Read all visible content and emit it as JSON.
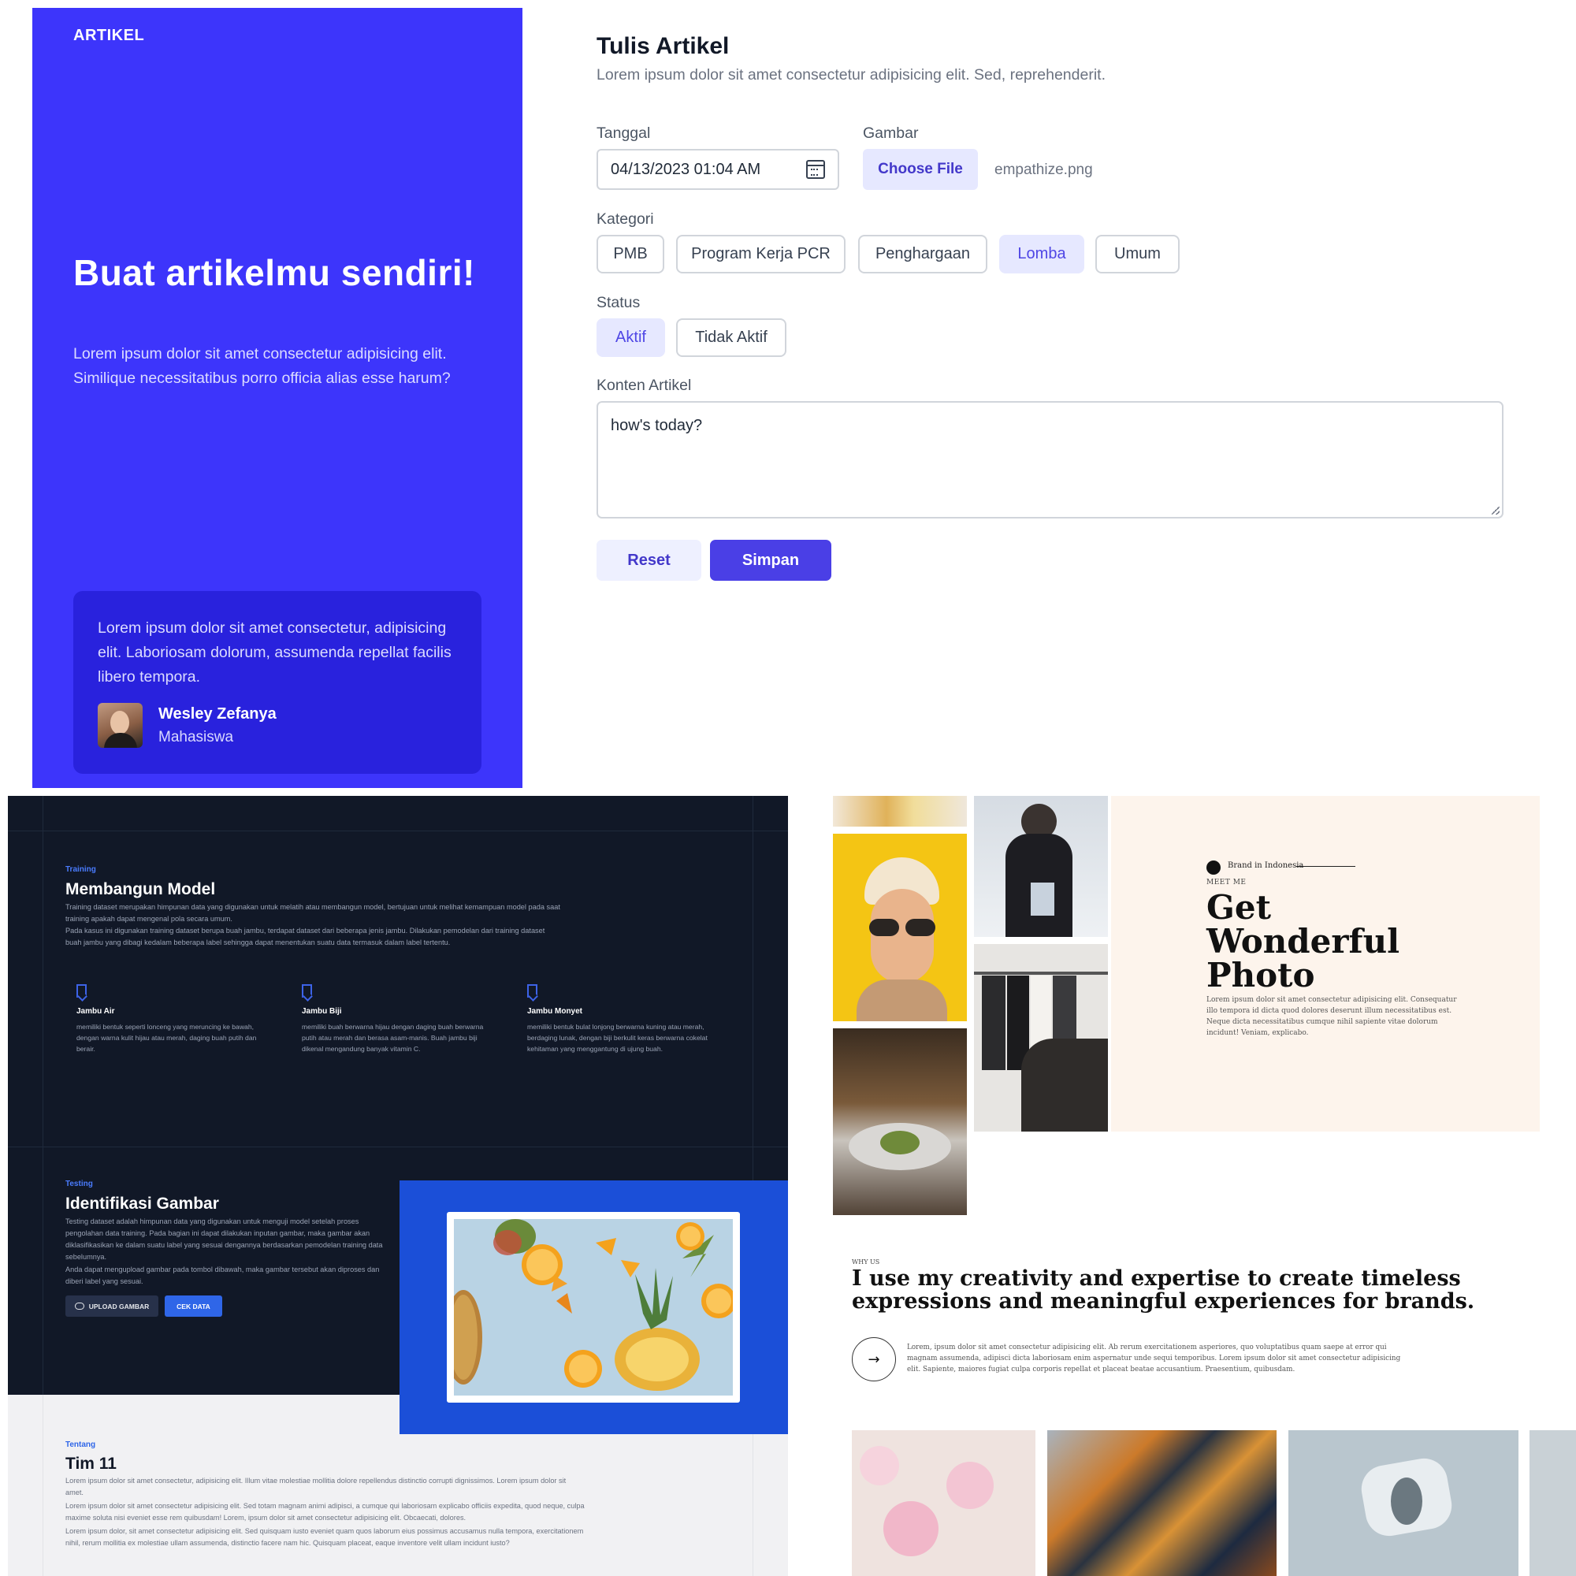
{
  "panel1": {
    "brand": "ARTIKEL",
    "hero_title": "Buat artikelmu sendiri!",
    "hero_sub": "Lorem ipsum dolor sit amet consectetur adipisicing elit. Similique necessitatibus porro officia alias esse harum?",
    "quote": "Lorem ipsum dolor sit amet consectetur, adipisicing elit. Laboriosam dolorum, assumenda repellat facilis libero tempora.",
    "author_name": "Wesley Zefanya",
    "author_role": "Mahasiswa",
    "form_title": "Tulis Artikel",
    "form_desc": "Lorem ipsum dolor sit amet consectetur adipisicing elit. Sed, reprehenderit.",
    "date_label": "Tanggal",
    "date_value": "04/13/2023 01:04  AM",
    "image_label": "Gambar",
    "choose_file": "Choose File",
    "file_name": "empathize.png",
    "category_label": "Kategori",
    "categories": [
      "PMB",
      "Program Kerja PCR",
      "Penghargaan",
      "Lomba",
      "Umum"
    ],
    "selected_category": "Lomba",
    "status_label": "Status",
    "statuses": [
      "Aktif",
      "Tidak Aktif"
    ],
    "selected_status": "Aktif",
    "content_label": "Konten Artikel",
    "content_value": "how's today?",
    "reset": "Reset",
    "save": "Simpan",
    "colors": {
      "primary": "#3d35fb",
      "button": "#4a3fe6"
    }
  },
  "panel2": {
    "training_eyebrow": "Training",
    "training_title": "Membangun Model",
    "training_p1": "Training dataset merupakan himpunan data yang digunakan untuk melatih atau membangun model, bertujuan untuk melihat kemampuan model pada saat training apakah dapat mengenal pola secara umum.",
    "training_p2": "Pada kasus ini digunakan training dataset berupa buah jambu, terdapat dataset dari beberapa jenis jambu. Dilakukan pemodelan dari training dataset buah jambu yang dibagi kedalam beberapa label sehingga dapat menentukan suatu data termasuk dalam label tertentu.",
    "cards": [
      {
        "title": "Jambu Air",
        "text": "memiliki bentuk seperti lonceng yang meruncing ke bawah, dengan warna kulit hijau atau merah, daging buah putih dan berair."
      },
      {
        "title": "Jambu Biji",
        "text": "memiliki buah berwarna hijau dengan daging buah berwarna putih atau merah dan berasa asam-manis. Buah jambu biji dikenal mengandung banyak vitamin C."
      },
      {
        "title": "Jambu Monyet",
        "text": "memiliki bentuk bulat lonjong berwarna kuning atau merah, berdaging lunak, dengan biji berkulit keras berwarna cokelat kehitaman yang menggantung di ujung buah."
      }
    ],
    "testing_eyebrow": "Testing",
    "testing_title": "Identifikasi Gambar",
    "testing_p1": "Testing dataset adalah himpunan data yang digunakan untuk menguji model setelah proses pengolahan data training. Pada bagian ini dapat dilakukan inputan gambar, maka gambar akan diklasifikasikan ke dalam suatu label yang sesuai dengannya berdasarkan pemodelan training data sebelumnya.",
    "testing_p2": "Anda dapat mengupload gambar pada tombol dibawah, maka gambar tersebut akan diproses dan diberi label yang sesuai.",
    "upload_button": "UPLOAD GAMBAR",
    "check_button": "CEK DATA",
    "about_eyebrow": "Tentang",
    "about_title": "Tim 11",
    "about_p1": "Lorem ipsum dolor sit amet consectetur, adipisicing elit. Illum vitae molestiae mollitia dolore repellendus distinctio corrupti dignissimos. Lorem ipsum dolor sit amet.",
    "about_p2": "Lorem ipsum dolor sit amet consectetur adipisicing elit. Sed totam magnam animi adipisci, a cumque qui laboriosam explicabo officiis expedita, quod neque, culpa maxime soluta nisi eveniet esse rem quibusdam! Lorem, ipsum dolor sit amet consectetur adipisicing elit. Obcaecati, dolores.",
    "about_p3": "Lorem ipsum dolor, sit amet consectetur adipisicing elit. Sed quisquam iusto eveniet quam quos laborum eius possimus accusamus nulla tempora, exercitationem nihil, rerum mollitia ex molestiae ullam assumenda, distinctio facere nam hic. Quisquam placeat, eaque inventore velit ullam incidunt iusto?"
  },
  "panel3": {
    "brand": "Brand in Indonesia",
    "meet": "MEET ME",
    "title": "Get Wonderful Photo",
    "paragraph": "Lorem ipsum dolor sit amet consectetur adipisicing elit. Consequatur illo tempora id dicta quod dolores deserunt illum necessitatibus est. Neque dicta necessitatibus cumque nihil sapiente vitae dolorum incidunt! Veniam, explicabo.",
    "why": "WHY US",
    "headline": "I use my creativity and expertise to create timeless expressions and meaningful experiences for brands.",
    "arrow": "→",
    "body": "Lorem, ipsum dolor sit amet consectetur adipisicing elit. Ab rerum exercitationem asperiores, quo voluptatibus quam saepe at error qui magnam assumenda, adipisci dicta laboriosam enim aspernatur unde sequi temporibus. Lorem ipsum dolor sit amet consectetur adipisicing elit. Sapiente, maiores fugiat culpa corporis repellat et placeat beatae accusantium. Praesentium, quibusdam."
  }
}
